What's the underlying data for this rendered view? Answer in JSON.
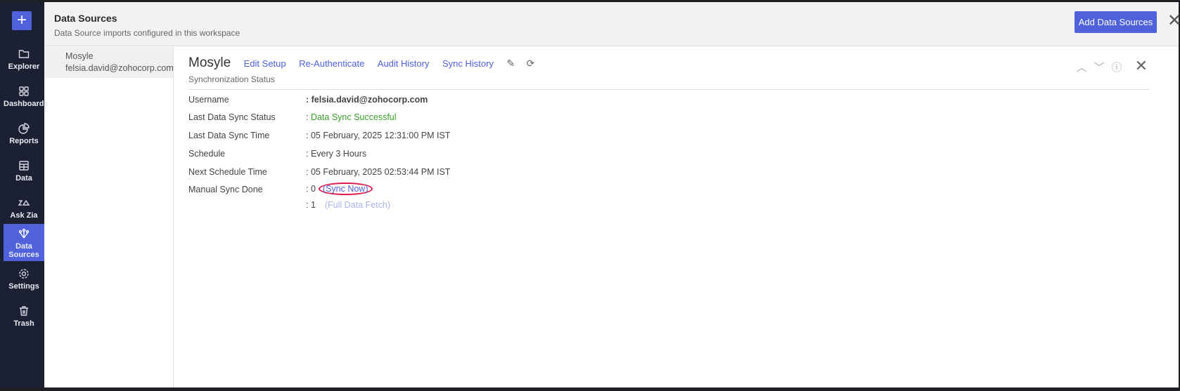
{
  "sidebar": {
    "items": [
      {
        "label": "Explorer",
        "icon": "folder-icon"
      },
      {
        "label": "Dashboards",
        "icon": "grid-icon"
      },
      {
        "label": "Reports",
        "icon": "pie-icon"
      },
      {
        "label": "Data",
        "icon": "table-icon"
      },
      {
        "label": "Ask Zia",
        "icon": "zia-icon"
      },
      {
        "label": "Data Sources",
        "icon": "data-sources-icon",
        "active": true
      },
      {
        "label": "Settings",
        "icon": "gear-icon"
      },
      {
        "label": "Trash",
        "icon": "trash-icon"
      }
    ]
  },
  "header": {
    "title": "Data Sources",
    "subtitle": "Data Source imports configured in this workspace",
    "add_button": "Add Data Sources"
  },
  "list": {
    "items": [
      {
        "name": "Mosyle",
        "email": "felsia.david@zohocorp.com"
      }
    ]
  },
  "detail": {
    "title": "Mosyle",
    "links": [
      "Edit Setup",
      "Re-Authenticate",
      "Audit History",
      "Sync History"
    ],
    "subtitle": "Synchronization Status",
    "rows": [
      {
        "label": "Username",
        "value": ": felsia.david@zohocorp.com"
      },
      {
        "label": "Last Data Sync Status",
        "value": ": ",
        "status": "Data Sync Successful"
      },
      {
        "label": "Last Data Sync Time",
        "value": ": 05 February, 2025 12:31:00 PM IST"
      },
      {
        "label": "Schedule",
        "value": ": Every 3 Hours"
      },
      {
        "label": "Next Schedule Time",
        "value": ": 05 February, 2025 02:53:44 PM IST"
      },
      {
        "label": "Manual Sync Done",
        "value": ": 0",
        "action": "(Sync Now)"
      }
    ],
    "extra_row": {
      "value": ": 1",
      "action": "(Full Data Fetch)"
    },
    "colors": {
      "accent": "#4f62dc",
      "success": "#3aa02b",
      "highlight": "#e0194c"
    }
  }
}
